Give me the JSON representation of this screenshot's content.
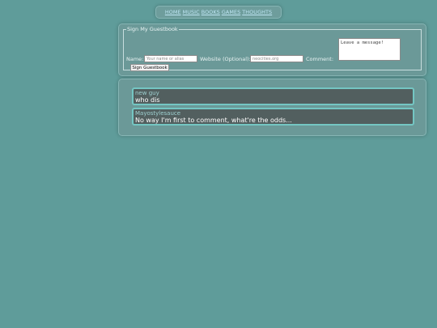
{
  "nav": {
    "items": [
      {
        "label": "HOME"
      },
      {
        "label": "MUSIC"
      },
      {
        "label": "BOOKS"
      },
      {
        "label": "GAMES"
      },
      {
        "label": "THOUGHTS"
      }
    ]
  },
  "guestbook_form": {
    "legend": "Sign My Guestbook",
    "name_label": "Name:",
    "name_placeholder": "Your name or alias",
    "website_label": "Website (Optional):",
    "website_placeholder": "neocities.org",
    "comment_label": "Comment:",
    "comment_placeholder": "Leave a message!",
    "submit_label": "Sign Guestbook"
  },
  "entries": [
    {
      "name": "new guy",
      "message": "who dis"
    },
    {
      "name": "Mayostylesauce",
      "message": "No way I'm first to comment, what're the odds..."
    }
  ],
  "colors": {
    "background": "#5f9c9a",
    "panel": "#6b9998",
    "entry_background": "#525f5f",
    "entry_border": "#74c6c3",
    "nav_link": "#bfe6f4"
  }
}
